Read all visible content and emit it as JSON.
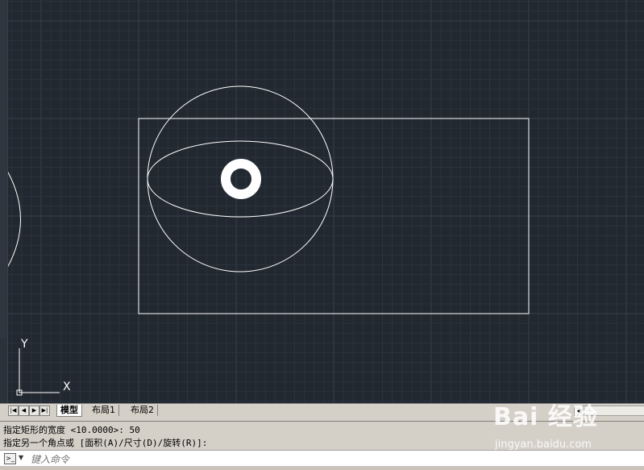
{
  "colors": {
    "canvas_bg": "#212830",
    "grid_minor": "#2b333d",
    "grid_major": "#36404b",
    "geometry": "#ffffff"
  },
  "ucs": {
    "y_label": "Y",
    "x_label": "X"
  },
  "tabs": [
    {
      "label": "模型",
      "active": true
    },
    {
      "label": "布局1",
      "active": false
    },
    {
      "label": "布局2",
      "active": false
    }
  ],
  "command_history": [
    "指定矩形的宽度 <10.0000>: 50",
    "指定另一个角点或 [面积(A)/尺寸(D)/旋转(R)]:"
  ],
  "command_line": {
    "placeholder": "键入命令"
  },
  "watermark": {
    "brand": "Bai 经验",
    "url": "jingyan.baidu.com"
  }
}
